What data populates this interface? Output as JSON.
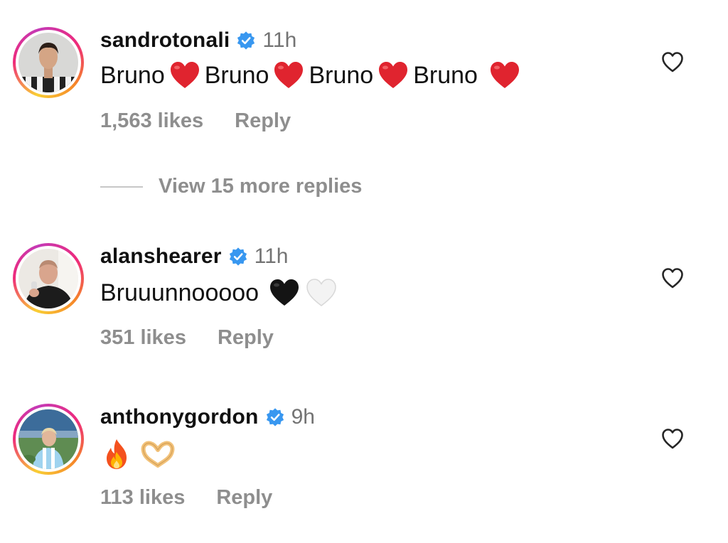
{
  "comments": [
    {
      "username": "sandrotonali",
      "time": "11h",
      "words": [
        "Bruno",
        "Bruno",
        "Bruno",
        "Bruno"
      ],
      "likes": "1,563 likes",
      "reply": "Reply"
    },
    {
      "username": "alanshearer",
      "time": "11h",
      "text": "Bruuunnooooo",
      "likes": "351 likes",
      "reply": "Reply"
    },
    {
      "username": "anthonygordon",
      "time": "9h",
      "likes": "113 likes",
      "reply": "Reply"
    }
  ],
  "view_replies": "View 15 more replies",
  "colors": {
    "verified": "#3897f0",
    "muted": "#8e8e8e",
    "red_heart": "#e0242f"
  },
  "icons": [
    "verified-badge-icon",
    "heart-outline-icon",
    "red-heart-emoji",
    "black-heart-emoji",
    "white-heart-emoji",
    "fire-emoji",
    "heart-hands-emoji"
  ]
}
